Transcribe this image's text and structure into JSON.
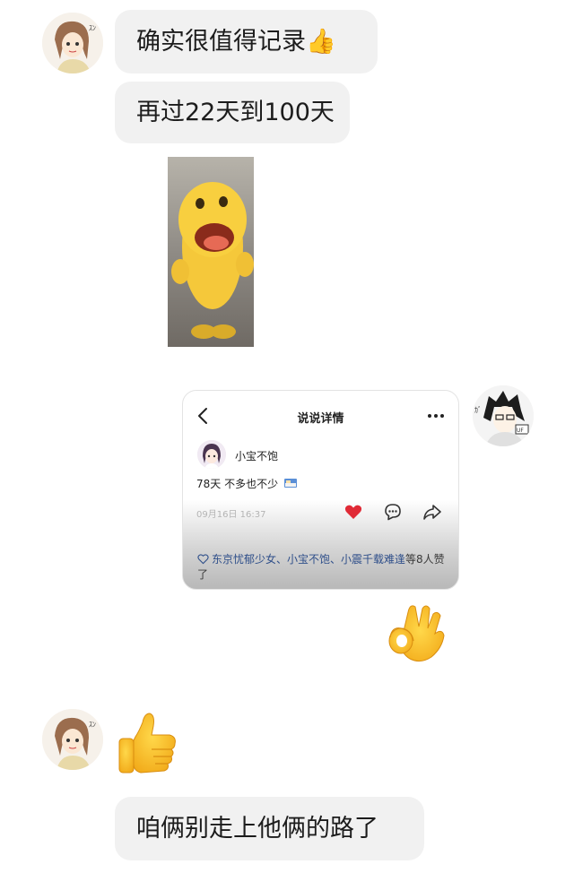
{
  "messages": {
    "m1": "确实很值得记录👍",
    "m2": "再过22天到100天",
    "m3": "咱俩别走上他俩的路了"
  },
  "shared_post": {
    "header_title": "说说详情",
    "username": "小宝不饱",
    "content": "78天 不多也不少",
    "time": "09月16日 16:37",
    "likes_names": "东京忧郁少女、小宝不饱、小震千载难逢",
    "likes_suffix": "等8人赞了"
  },
  "stickers": {
    "gif": "laughing-yellow-blob",
    "ok": "ok-hand-emoji",
    "thumbs": "thumbs-up-emoji"
  },
  "colors": {
    "bubble": "#f1f1f1",
    "heart": "#e02a36",
    "link": "#2f4f8a"
  }
}
